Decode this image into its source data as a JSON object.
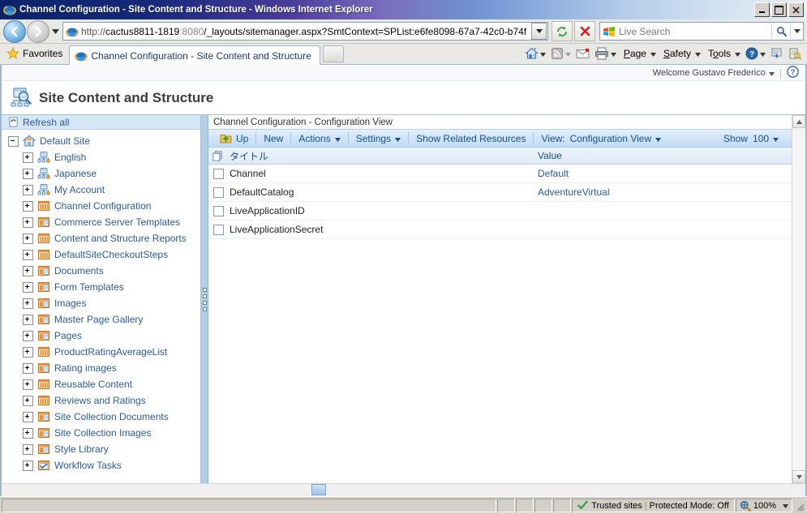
{
  "window": {
    "title": "Channel Configuration - Site Content and Structure - Windows Internet Explorer",
    "minimize_label": "_",
    "maximize_label": "□",
    "close_label": "✕"
  },
  "address_bar": {
    "url_scheme": "http://",
    "url_host": "cactus8811-1819",
    "url_port": ":8080",
    "url_path": "/_layouts/sitemanager.aspx?SmtContext=SPList:e6fe8098-67a7-42c0-b74f",
    "dropdown_icon": "chevron-down-icon",
    "refresh_icon": "refresh-icon",
    "stop_icon": "stop-icon"
  },
  "search": {
    "placeholder": "Live Search",
    "go_icon": "magnifier-icon",
    "dropdown_icon": "chevron-down-icon"
  },
  "favorites": {
    "label": "Favorites",
    "icon": "star-icon"
  },
  "tabs": [
    {
      "label": "Channel Configuration - Site Content and Structure",
      "icon": "ie-logo-icon",
      "active": true
    }
  ],
  "new_tab": {
    "name": "new-tab-button"
  },
  "command_bar": [
    {
      "name": "home-button",
      "icon": "home-icon",
      "label": "",
      "has_arrow": true
    },
    {
      "name": "feeds-button",
      "icon": "rss-icon",
      "label": "",
      "has_arrow": true
    },
    {
      "name": "read-mail-button",
      "icon": "mail-icon",
      "label": "",
      "has_arrow": false
    },
    {
      "name": "print-button",
      "icon": "printer-icon",
      "label": "",
      "has_arrow": true
    },
    {
      "name": "page-menu",
      "icon": "",
      "label": "Page",
      "has_arrow": true
    },
    {
      "name": "safety-menu",
      "icon": "",
      "label": "Safety",
      "has_arrow": true
    },
    {
      "name": "tools-menu",
      "icon": "",
      "label": "Tools",
      "has_arrow": true
    },
    {
      "name": "help-menu",
      "icon": "help-icon",
      "label": "",
      "has_arrow": true
    },
    {
      "name": "compatibility-button",
      "icon": "compatibility-icon",
      "label": "",
      "has_arrow": false
    },
    {
      "name": "research-button",
      "icon": "research-icon",
      "label": "",
      "has_arrow": false
    }
  ],
  "sharepoint": {
    "welcome_text": "Welcome Gustavo Frederico",
    "welcome_arrow": "chevron-down-icon",
    "help_icon": "help-circle-icon",
    "page_title": "Site Content and Structure",
    "page_icon": "sitemap-search-icon"
  },
  "tree": {
    "refresh_all_label": "Refresh all",
    "refresh_icon": "refresh-page-icon",
    "root": {
      "label": "Default Site",
      "icon": "site-home-icon",
      "expander": "minus"
    },
    "items": [
      {
        "label": "English",
        "icon": "subsite-icon",
        "expander": "plus"
      },
      {
        "label": "Japanese",
        "icon": "subsite-icon",
        "expander": "plus"
      },
      {
        "label": "My Account",
        "icon": "subsite-icon",
        "expander": "plus"
      },
      {
        "label": "Channel Configuration",
        "icon": "list-icon",
        "expander": "plus"
      },
      {
        "label": "Commerce Server Templates",
        "icon": "library-icon",
        "expander": "plus"
      },
      {
        "label": "Content and Structure Reports",
        "icon": "list-icon",
        "expander": "plus"
      },
      {
        "label": "DefaultSiteCheckoutSteps",
        "icon": "list-icon",
        "expander": "plus"
      },
      {
        "label": "Documents",
        "icon": "library-icon",
        "expander": "plus"
      },
      {
        "label": "Form Templates",
        "icon": "library-icon",
        "expander": "plus"
      },
      {
        "label": "Images",
        "icon": "library-icon",
        "expander": "plus"
      },
      {
        "label": "Master Page Gallery",
        "icon": "library-icon",
        "expander": "plus"
      },
      {
        "label": "Pages",
        "icon": "library-icon",
        "expander": "plus"
      },
      {
        "label": "ProductRatingAverageList",
        "icon": "list-icon",
        "expander": "plus"
      },
      {
        "label": "Rating images",
        "icon": "library-icon",
        "expander": "plus"
      },
      {
        "label": "Reusable Content",
        "icon": "list-icon",
        "expander": "plus"
      },
      {
        "label": "Reviews and Ratings",
        "icon": "list-icon",
        "expander": "plus"
      },
      {
        "label": "Site Collection Documents",
        "icon": "library-icon",
        "expander": "plus"
      },
      {
        "label": "Site Collection Images",
        "icon": "library-icon",
        "expander": "plus"
      },
      {
        "label": "Style Library",
        "icon": "library-icon",
        "expander": "plus"
      },
      {
        "label": "Workflow Tasks",
        "icon": "tasks-icon",
        "expander": "plus"
      }
    ]
  },
  "content": {
    "breadcrumb": "Channel Configuration - Configuration View",
    "toolbar": {
      "up_label": "Up",
      "up_icon": "folder-up-icon",
      "new_label": "New",
      "actions_label": "Actions",
      "settings_label": "Settings",
      "show_related_label": "Show Related Resources",
      "view_label": "View:",
      "view_value": "Configuration View",
      "show_label": "Show",
      "show_value": "100",
      "arrow_icon": "chevron-down-icon"
    },
    "columns": {
      "title": "タイトル",
      "value": "Value",
      "select_all_icon": "select-all-icon"
    },
    "rows": [
      {
        "title": "Channel",
        "value": "Default"
      },
      {
        "title": "DefaultCatalog",
        "value": "AdventureVirtual"
      },
      {
        "title": "LiveApplicationID",
        "value": ""
      },
      {
        "title": "LiveApplicationSecret",
        "value": ""
      }
    ]
  },
  "status_bar": {
    "zone_text": "Trusted sites",
    "zone_separator": "|",
    "protected_mode": "Protected Mode: Off",
    "zone_icon": "check-shield-icon",
    "zoom_level": "100%",
    "zoom_icon": "zoom-magnifier-icon",
    "zoom_arrow": "chevron-down-icon"
  },
  "colors": {
    "title_bar_start": "#0a246a",
    "link_blue": "#2a5b9a",
    "toolbar_blue": "#cfe4f7",
    "splitter_blue": "#b3cfe8",
    "refresh_band": "#d5e7f7"
  }
}
